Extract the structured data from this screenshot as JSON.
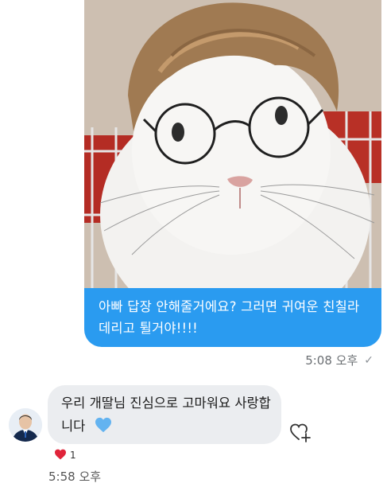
{
  "outgoing": {
    "message": "아빠 답장 안해줄거에요? 그러면 귀여운 친칠라 데리고 튈거야!!!!",
    "time": "5:08 오후",
    "status_icon": "check-icon",
    "bubble_color": "#2a9bf0"
  },
  "incoming": {
    "message": "우리 개딸님 진심으로 고마워요 사랑합니다",
    "emoji": "blue-heart",
    "time": "5:58 오후",
    "reaction": {
      "icon": "red-heart",
      "count": "1"
    },
    "bubble_color": "#ebedf0"
  }
}
